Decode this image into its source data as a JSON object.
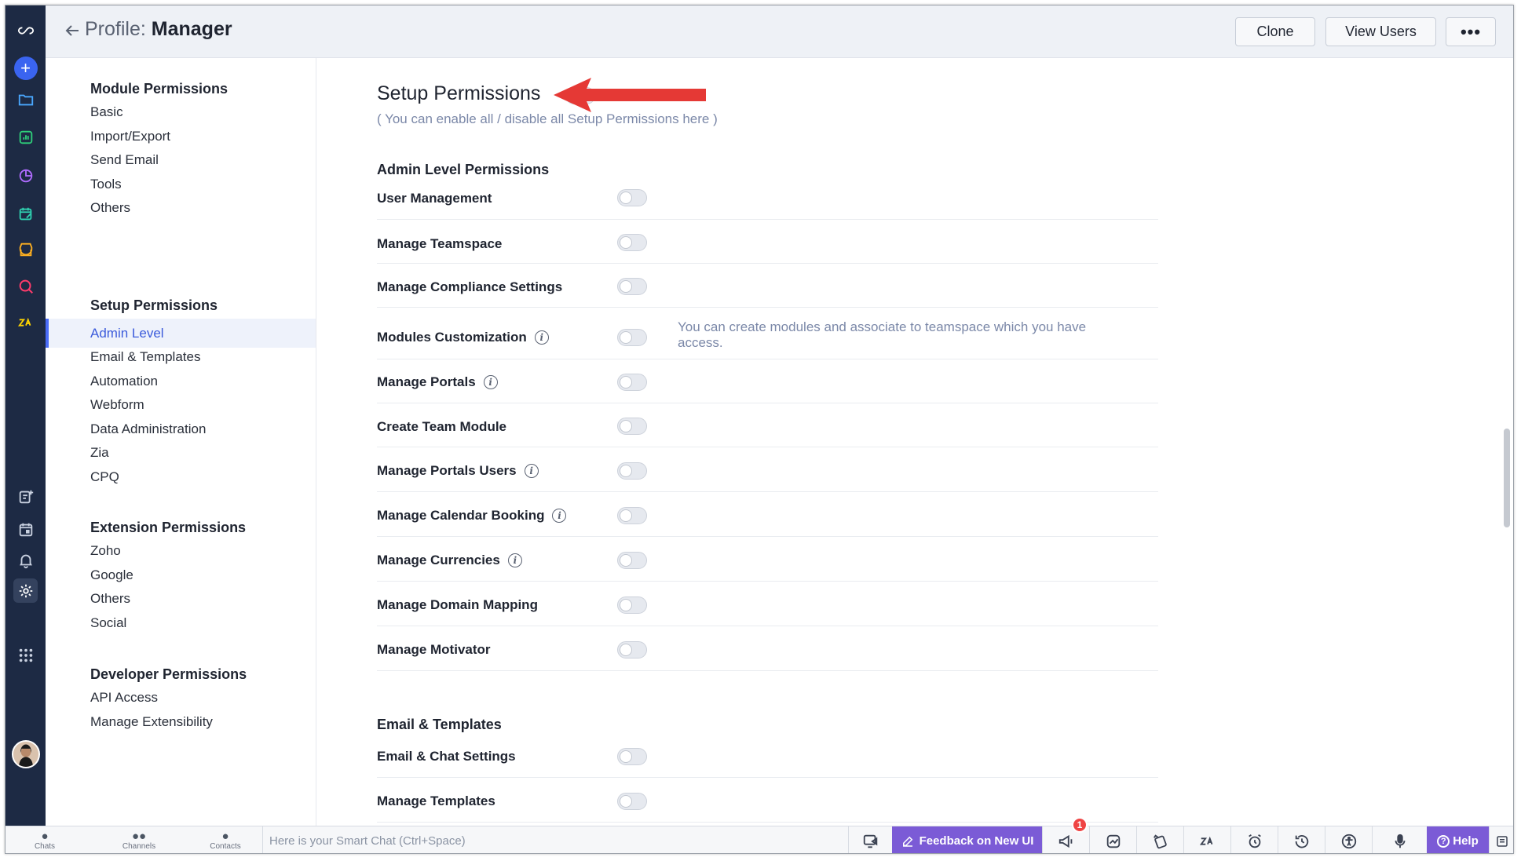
{
  "header": {
    "title_prefix": "Profile:",
    "title_name": "Manager",
    "clone_label": "Clone",
    "view_users_label": "View Users",
    "more_label": "•••"
  },
  "subnav": {
    "sections": [
      {
        "title": "Module Permissions",
        "items": [
          "Basic",
          "Import/Export",
          "Send Email",
          "Tools",
          "Others"
        ]
      },
      {
        "title": "Setup Permissions",
        "items": [
          "Admin Level",
          "Email & Templates",
          "Automation",
          "Webform",
          "Data Administration",
          "Zia",
          "CPQ"
        ]
      },
      {
        "title": "Extension Permissions",
        "items": [
          "Zoho",
          "Google",
          "Others",
          "Social"
        ]
      },
      {
        "title": "Developer Permissions",
        "items": [
          "API Access",
          "Manage Extensibility"
        ]
      }
    ],
    "active_item": "Admin Level"
  },
  "main": {
    "title": "Setup Permissions",
    "subtitle": "( You can enable all / disable all Setup Permissions here )",
    "groups": [
      {
        "title": "Admin Level Permissions",
        "rows": [
          {
            "label": "User Management",
            "info": false,
            "enabled": false
          },
          {
            "label": "Manage Teamspace",
            "info": false,
            "enabled": false
          },
          {
            "label": "Manage Compliance Settings",
            "info": false,
            "enabled": false
          },
          {
            "label": "Modules Customization",
            "info": true,
            "enabled": false,
            "description": "You can create modules and associate to teamspace which you have access."
          },
          {
            "label": "Manage Portals",
            "info": true,
            "enabled": false
          },
          {
            "label": "Create Team Module",
            "info": false,
            "enabled": false
          },
          {
            "label": "Manage Portals Users",
            "info": true,
            "enabled": false
          },
          {
            "label": "Manage Calendar Booking",
            "info": true,
            "enabled": false
          },
          {
            "label": "Manage Currencies",
            "info": true,
            "enabled": false
          },
          {
            "label": "Manage Domain Mapping",
            "info": false,
            "enabled": false
          },
          {
            "label": "Manage Motivator",
            "info": false,
            "enabled": false
          }
        ]
      },
      {
        "title": "Email & Templates",
        "rows": [
          {
            "label": "Email & Chat Settings",
            "info": false,
            "enabled": false
          },
          {
            "label": "Manage Templates",
            "info": false,
            "enabled": false
          }
        ]
      }
    ]
  },
  "bottom": {
    "chats": "Chats",
    "channels": "Channels",
    "contacts": "Contacts",
    "smart_chat_placeholder": "Here is your Smart Chat (Ctrl+Space)",
    "feedback": "Feedback on New UI",
    "notification_count": "1",
    "help": "Help"
  },
  "colors": {
    "rail": "#1d2a44",
    "accent": "#3b5bdb",
    "feedback": "#7b5bd6",
    "arrow": "#e53935"
  }
}
